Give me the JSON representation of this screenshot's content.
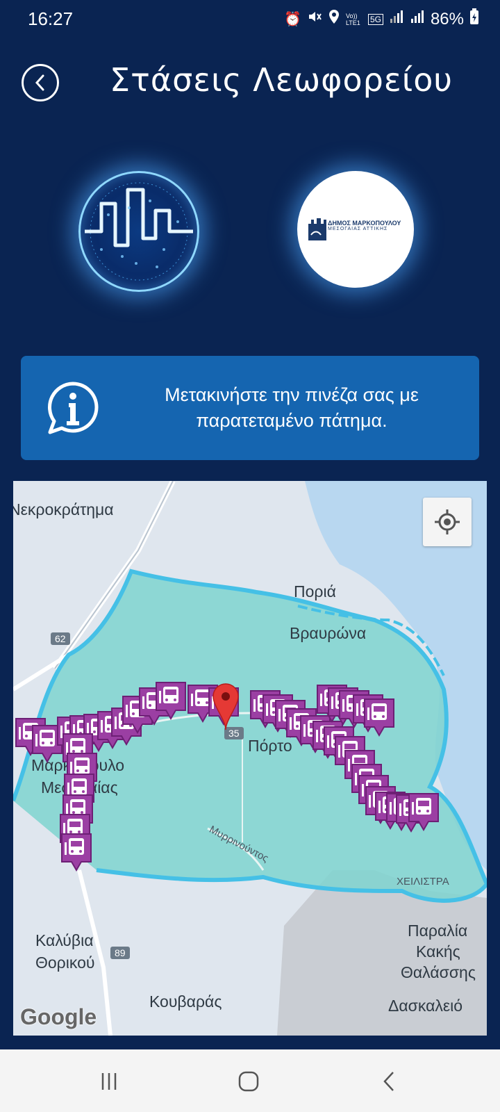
{
  "status": {
    "time": "16:27",
    "battery": "86%",
    "icons": [
      "alarm-icon",
      "mute-icon",
      "location-icon",
      "volte-icon",
      "5g-icon",
      "signal-icon",
      "signal-icon",
      "battery-icon"
    ],
    "volte_label": "Vo)) LTE1",
    "network_label": "5G"
  },
  "header": {
    "title": "Στάσεις Λεωφορείου",
    "back_icon": "chevron-left-icon"
  },
  "logos": {
    "municipality_name": "ΔΗΜΟΣ ΜΑΡΚΟΠΟΥΛΟΥ",
    "municipality_sub": "ΜΕΣΟΓΑΙΑΣ ΑΤΤΙΚΗΣ"
  },
  "info": {
    "text": "Μετακινήστε την πινέζα σας με παρατεταμένο πάτημα.",
    "icon": "info-bubble-icon"
  },
  "map": {
    "labels": {
      "nekrokratima": "Νεκροκράτημα",
      "poria": "Πoριά",
      "vravrona": "Βραυρώνα",
      "markopoulo1": "Μαρκόπουλο",
      "markopoulo2": "Μεσογαίας",
      "porto": "Πόρτο",
      "myrrinountos": "Μυρρινούντος",
      "cheilistra": "ΧΕΙΛΙΣΤΡΑ",
      "kalyvia1": "Καλύβια",
      "kalyvia2": "Θορικού",
      "kouvaras": "Κουβαράς",
      "paralia1": "Παραλία",
      "paralia2": "Κακής",
      "paralia3": "Θαλάσσης",
      "daskaleio": "Δασκαλειό"
    },
    "road_badges": {
      "r62": "62",
      "r89": "89",
      "r35": "35"
    },
    "attribution": "Google",
    "locate_icon": "my-location-icon",
    "marker_icon": "map-pin-icon",
    "stop_icon": "bus-stop-icon",
    "stop_color": "#9b3fa3",
    "zone_color": "#7fd4cf",
    "border_color": "#45c0e6"
  },
  "navbar": {
    "recents_icon": "recents-icon",
    "home_icon": "home-icon",
    "back_icon": "back-icon"
  }
}
